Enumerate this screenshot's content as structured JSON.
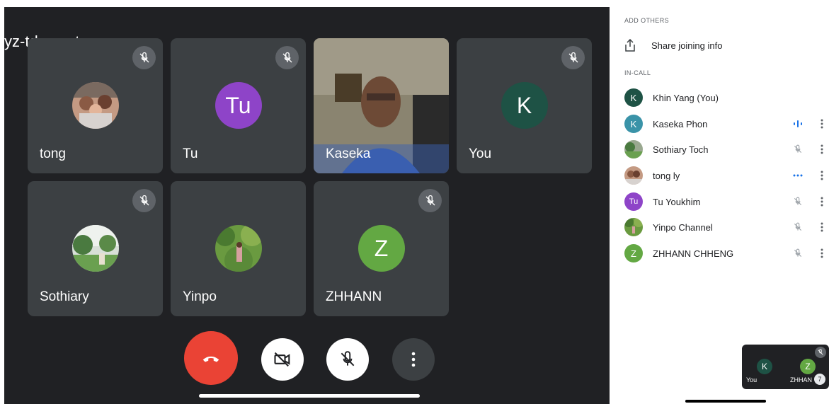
{
  "meeting": {
    "code": "yz-tdxz-yat"
  },
  "colors": {
    "stage_bg": "#202124",
    "tile_bg": "#3c4043",
    "end_call_red": "#ea4335",
    "tu_purple": "#8e44c8",
    "k_green": "#1e5245",
    "z_green": "#63a843",
    "kaseka_teal": "#3a93a8"
  },
  "tiles": [
    {
      "name": "tong",
      "avatar": "photo-family",
      "muted": true
    },
    {
      "name": "Tu",
      "avatar_letter": "Tu",
      "muted": true
    },
    {
      "name": "Kaseka",
      "avatar": "camera-video",
      "muted": false
    },
    {
      "name": "You",
      "avatar_letter": "K",
      "muted": true
    },
    {
      "name": "Sothiary",
      "avatar": "photo-garden",
      "muted": true
    },
    {
      "name": "Yinpo",
      "avatar": "photo-trees",
      "muted": true
    },
    {
      "name": "ZHHANN",
      "avatar_letter": "Z",
      "muted": true
    }
  ],
  "controls": {
    "end_call": "end-call-icon",
    "camera": "camera-off-icon",
    "mic": "mic-off-icon",
    "more": "more-vert-icon"
  },
  "panel": {
    "add_others_heading": "ADD OTHERS",
    "share_label": "Share joining info",
    "in_call_heading": "IN-CALL",
    "people": [
      {
        "name": "Khin Yang (You)",
        "avatar_letter": "K",
        "status": "none"
      },
      {
        "name": "Kaseka Phon",
        "avatar_letter": "K",
        "status": "speaking"
      },
      {
        "name": "Sothiary Toch",
        "avatar": "photo",
        "status": "muted"
      },
      {
        "name": "tong ly",
        "avatar": "photo",
        "status": "typing"
      },
      {
        "name": "Tu Youkhim",
        "avatar_letter": "Tu",
        "status": "muted"
      },
      {
        "name": "Yinpo Channel",
        "avatar": "photo",
        "status": "muted"
      },
      {
        "name": "ZHHANN CHHENG",
        "avatar_letter": "Z",
        "status": "muted"
      }
    ]
  },
  "pip": {
    "self_letter": "K",
    "self_label": "You",
    "other_letter": "Z",
    "other_label": "ZHHAN",
    "count": "7"
  }
}
